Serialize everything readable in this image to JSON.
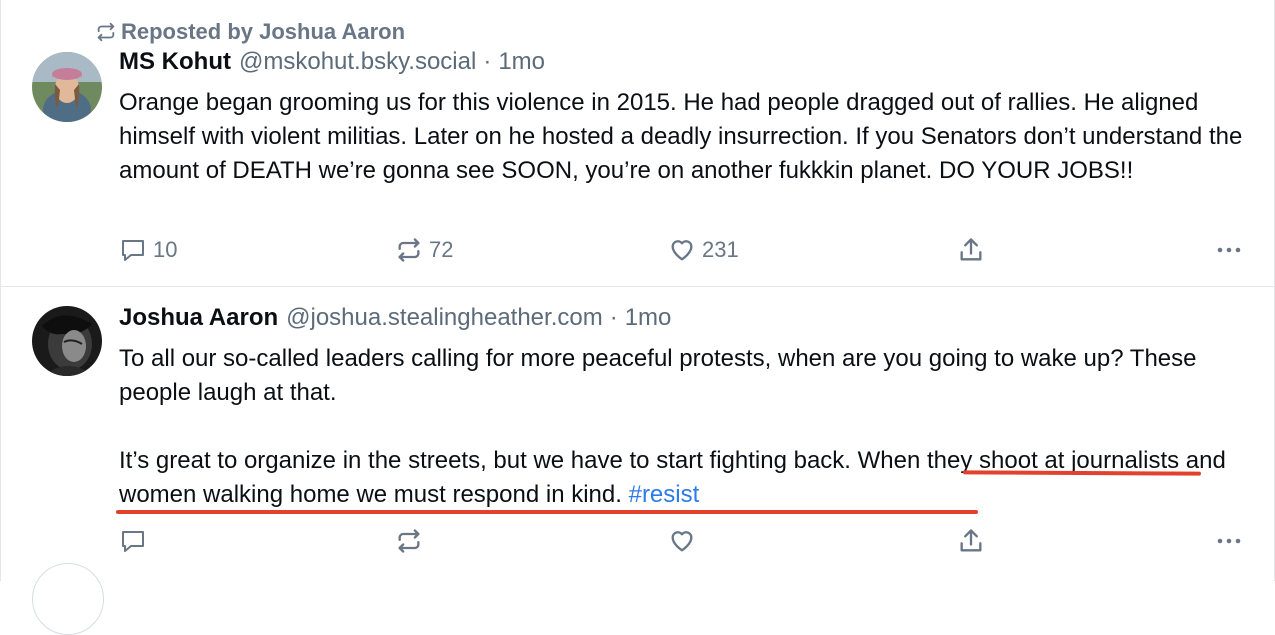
{
  "post1": {
    "repost_label": "Reposted by Joshua Aaron",
    "author_name": "MS Kohut",
    "handle": "@mskohut.bsky.social",
    "separator": "·",
    "time": "1mo",
    "text": "Orange began grooming us for this violence in 2015. He had people dragged out of rallies. He aligned himself with violent militias. Later on he hosted a deadly insurrection. If you Senators don’t understand the amount of DEATH we’re gonna see SOON, you’re on another fukkkin planet. DO YOUR JOBS!!",
    "reply_count": "10",
    "repost_count": "72",
    "like_count": "231"
  },
  "post2": {
    "author_name": "Joshua Aaron",
    "handle": "@joshua.stealingheather.com",
    "separator": "·",
    "time": "1mo",
    "text_para1": "To all our so-called leaders calling for more peaceful protests, when are you going to wake up? These people laugh at that.",
    "text_para2": "It’s great to organize in the streets, but we have to start fighting back. When they shoot at journalists and women walking home we must respond in kind.",
    "hashtag": "#resist"
  },
  "icons": {
    "repost": "repost-icon",
    "reply": "reply-icon",
    "like": "heart-icon",
    "share": "share-icon",
    "more": "more-icon"
  },
  "colors": {
    "muted": "#687686",
    "link": "#2d7be8",
    "annotation": "#e2412d",
    "divider": "#e3e7ec"
  }
}
